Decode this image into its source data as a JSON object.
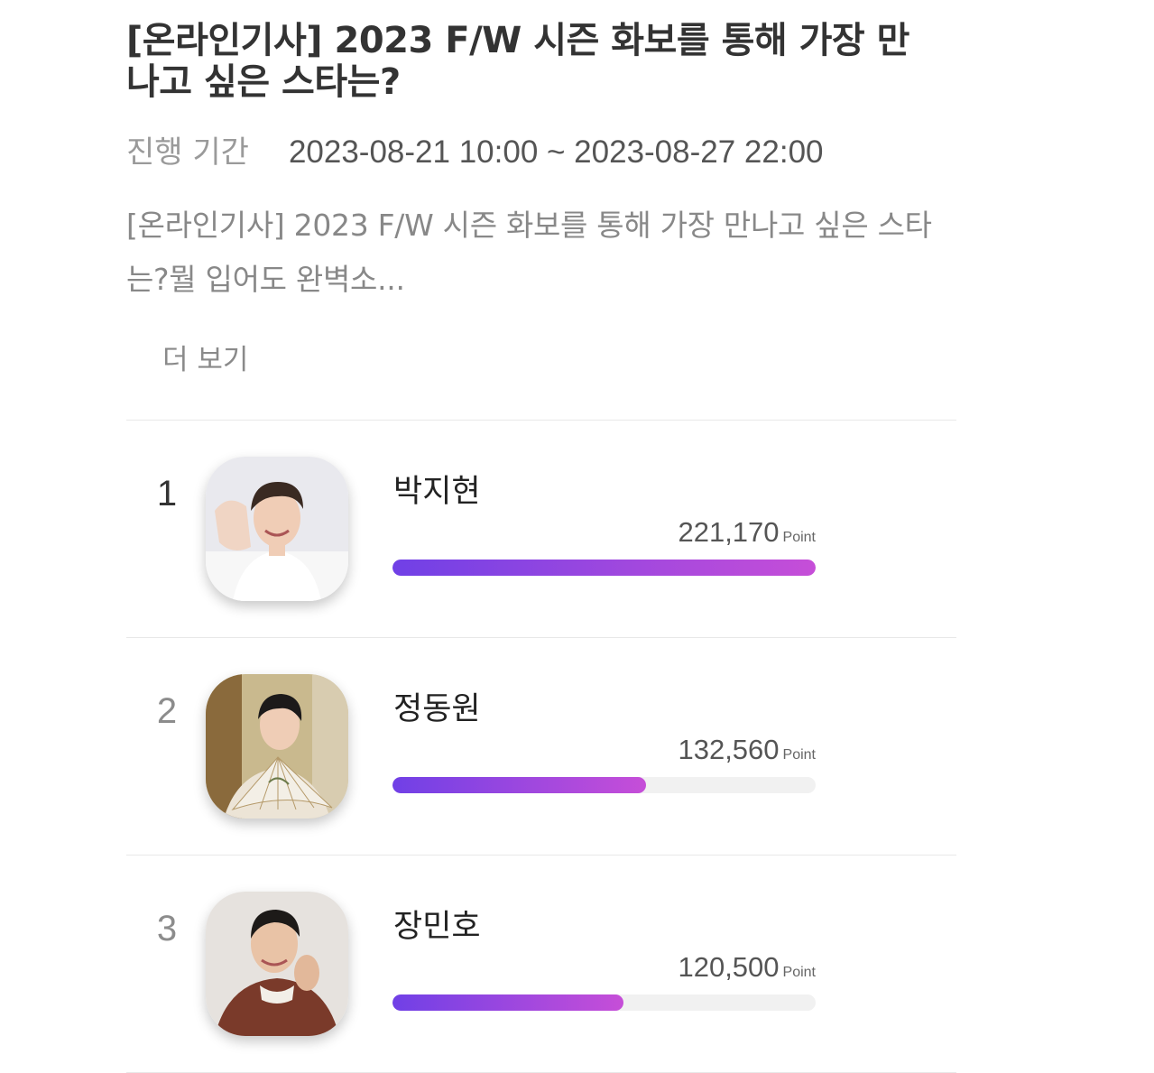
{
  "vote": {
    "title": "[온라인기사] 2023 F/W 시즌 화보를 통해 가장 만나고 싶은 스타는?",
    "period_label": "진행 기간",
    "period_value": "2023-08-21 10:00 ~ 2023-08-27 22:00",
    "description": "[온라인기사] 2023 F/W 시즌 화보를 통해 가장 만나고 싶은 스타는?뭘 입어도 완벽소...",
    "more_label": "더 보기"
  },
  "ranking": [
    {
      "rank": "1",
      "name": "박지현",
      "score": "221,170",
      "unit": "Point",
      "share": 1.0
    },
    {
      "rank": "2",
      "name": "정동원",
      "score": "132,560",
      "unit": "Point",
      "share": 0.599
    },
    {
      "rank": "3",
      "name": "장민호",
      "score": "120,500",
      "unit": "Point",
      "share": 0.545
    }
  ],
  "colors": {
    "bar_start": "#7040e6",
    "bar_end": "#c64ed8",
    "bar_track": "#f1f1f1"
  }
}
